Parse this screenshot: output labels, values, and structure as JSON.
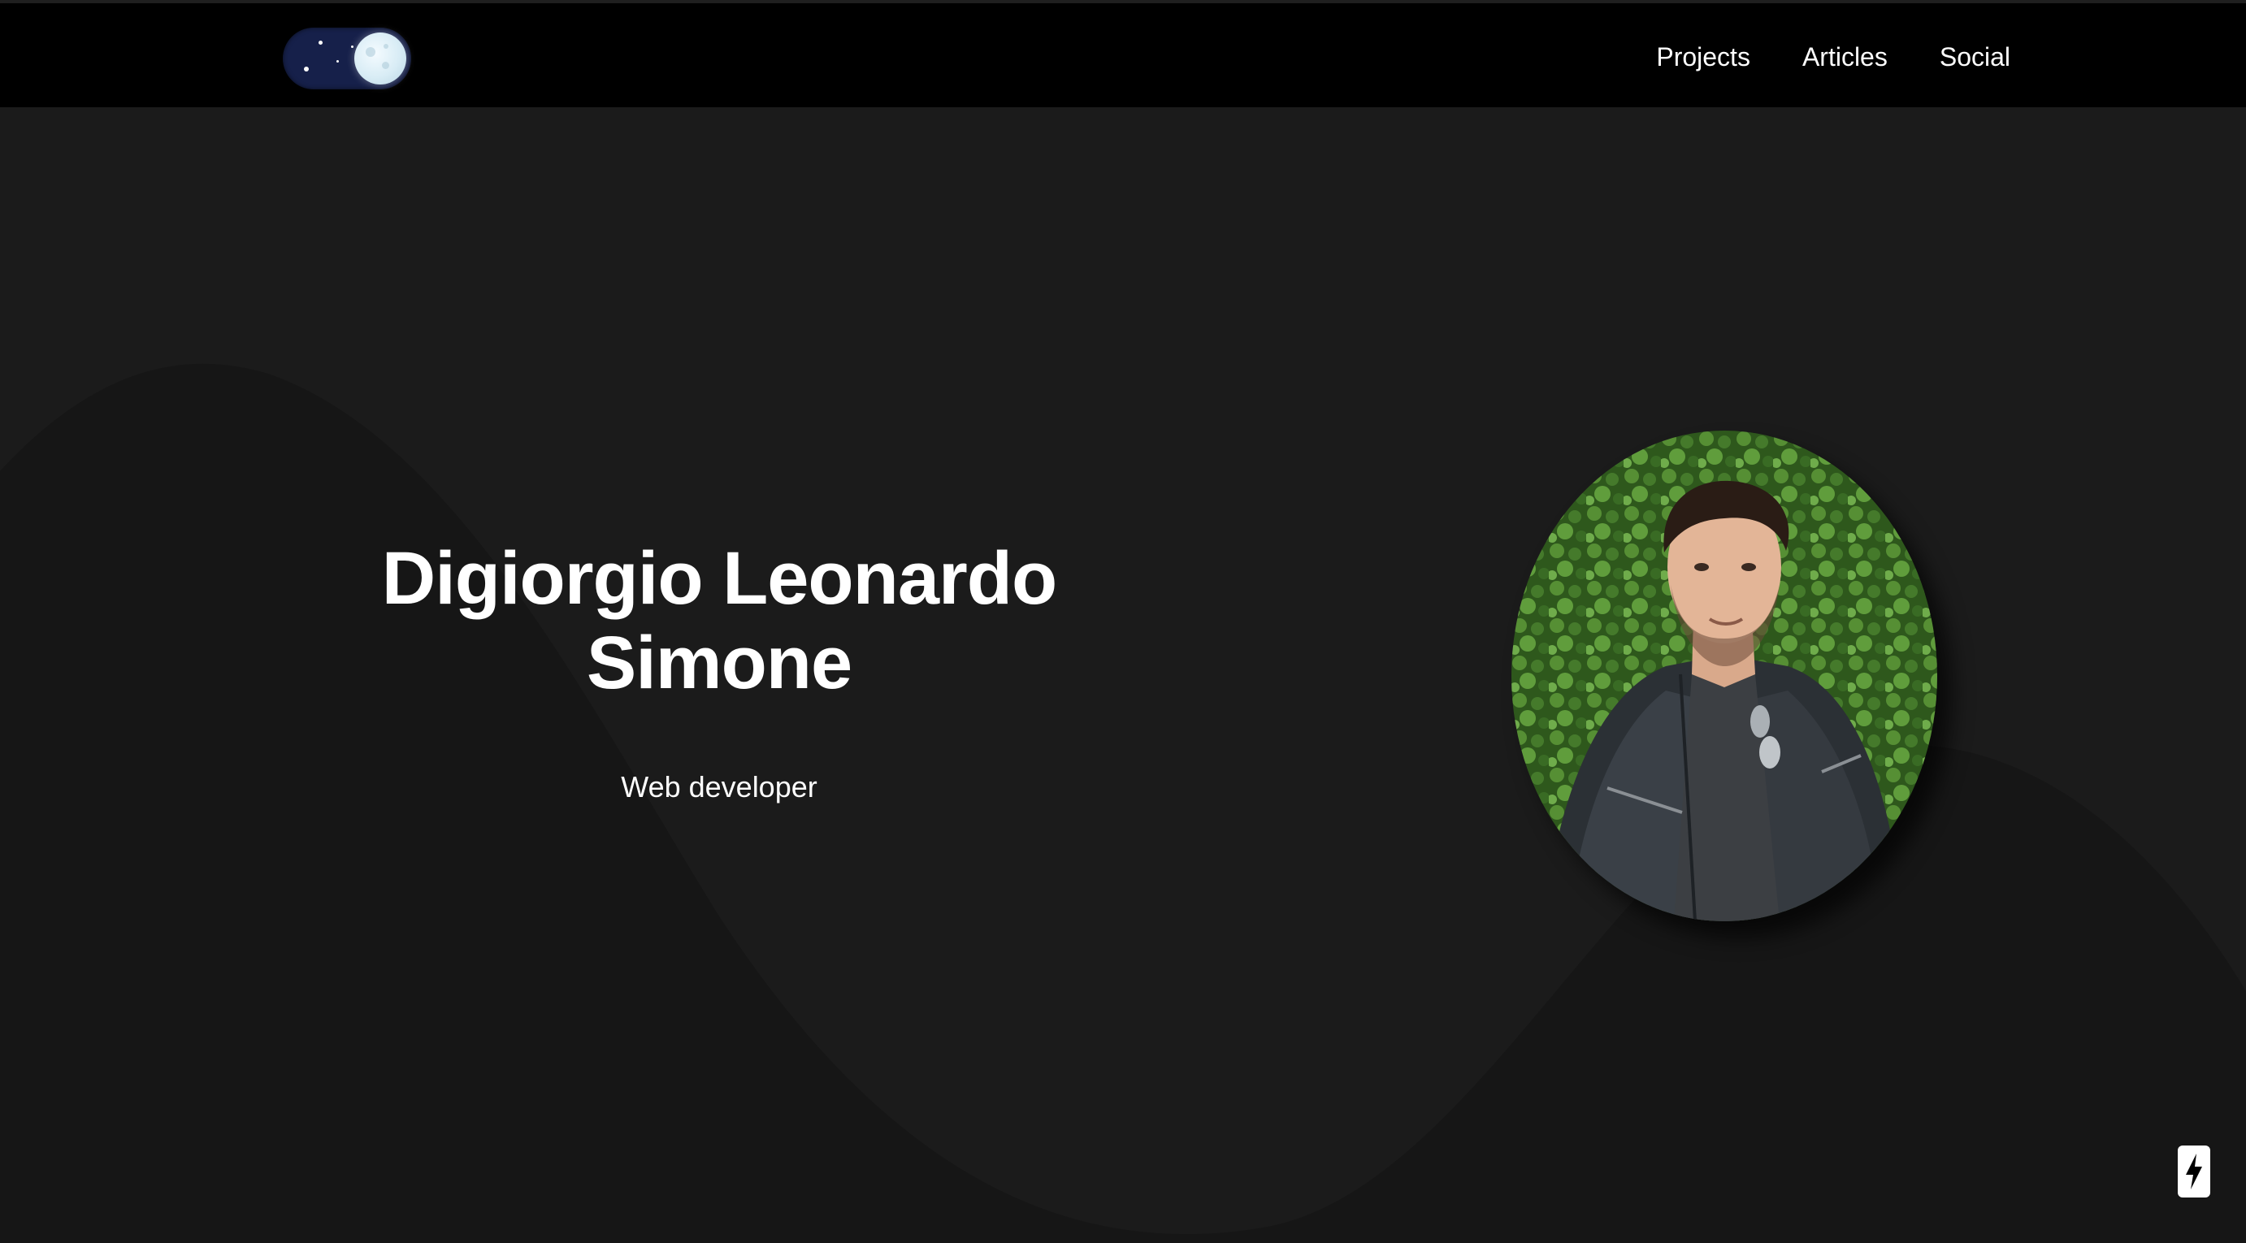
{
  "theme_toggle": {
    "state": "dark",
    "icon": "moon-icon"
  },
  "nav": {
    "items": [
      {
        "label": "Projects"
      },
      {
        "label": "Articles"
      },
      {
        "label": "Social"
      }
    ]
  },
  "hero": {
    "name_line1": "Digiorgio Leonardo",
    "name_line2": "Simone",
    "role": "Web developer"
  },
  "avatar": {
    "icon": "profile-photo"
  },
  "badge": {
    "icon": "lightning-bolt-icon"
  },
  "colors": {
    "header_bg": "#000000",
    "page_bg": "#1b1b1b",
    "wave_bg": "#161616",
    "toggle_bg": "#16204a",
    "text": "#ffffff"
  }
}
